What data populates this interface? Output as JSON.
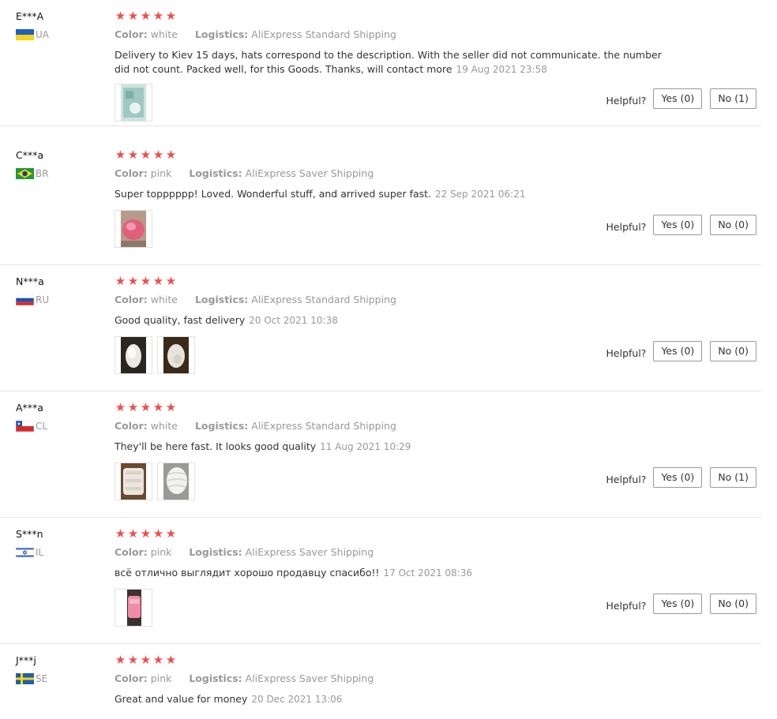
{
  "helpful_label": "Helpful?",
  "logistics_label": "Logistics:",
  "color_label": "Color:",
  "star_glyph": "★",
  "accent_color": "#f04d4d",
  "reviews": [
    {
      "user": "E***A",
      "country": "UA",
      "flag": "ua-flag-icon",
      "rating": 5,
      "color": "white",
      "logistics": "AliExpress Standard Shipping",
      "text": "Delivery to Kiev 15 days, hats correspond to the description. With the seller did not communicate. the number did not count. Packed well, for this Goods. Thanks, will contact more",
      "date": "19 Aug 2021 23:58",
      "yes": "Yes (0)",
      "no": "No (1)"
    },
    {
      "user": "C***a",
      "country": "BR",
      "flag": "br-flag-icon",
      "rating": 5,
      "color": "pink",
      "logistics": "AliExpress Saver Shipping",
      "text": "Super topppppp! Loved. Wonderful stuff, and arrived super fast.",
      "date": "22 Sep 2021 06:21",
      "yes": "Yes (0)",
      "no": "No (0)"
    },
    {
      "user": "N***a",
      "country": "RU",
      "flag": "ru-flag-icon",
      "rating": 5,
      "color": "white",
      "logistics": "AliExpress Standard Shipping",
      "text": "Good quality, fast delivery",
      "date": "20 Oct 2021 10:38",
      "yes": "Yes (0)",
      "no": "No (0)"
    },
    {
      "user": "A***a",
      "country": "CL",
      "flag": "cl-flag-icon",
      "rating": 5,
      "color": "white",
      "logistics": "AliExpress Standard Shipping",
      "text": "They'll be here fast. It looks good quality",
      "date": "11 Aug 2021 10:29",
      "yes": "Yes (0)",
      "no": "No (1)"
    },
    {
      "user": "S***n",
      "country": "IL",
      "flag": "il-flag-icon",
      "rating": 5,
      "color": "pink",
      "logistics": "AliExpress Saver Shipping",
      "text": "всё отлично выглядит хорошо продавцу спасибо!!",
      "date": "17 Oct 2021 08:36",
      "yes": "Yes (0)",
      "no": "No (0)"
    },
    {
      "user": "J***j",
      "country": "SE",
      "flag": "se-flag-icon",
      "rating": 5,
      "color": "pink",
      "logistics": "AliExpress Saver Shipping",
      "text": "Great and value for money",
      "date": "20 Dec 2021 13:06"
    }
  ]
}
